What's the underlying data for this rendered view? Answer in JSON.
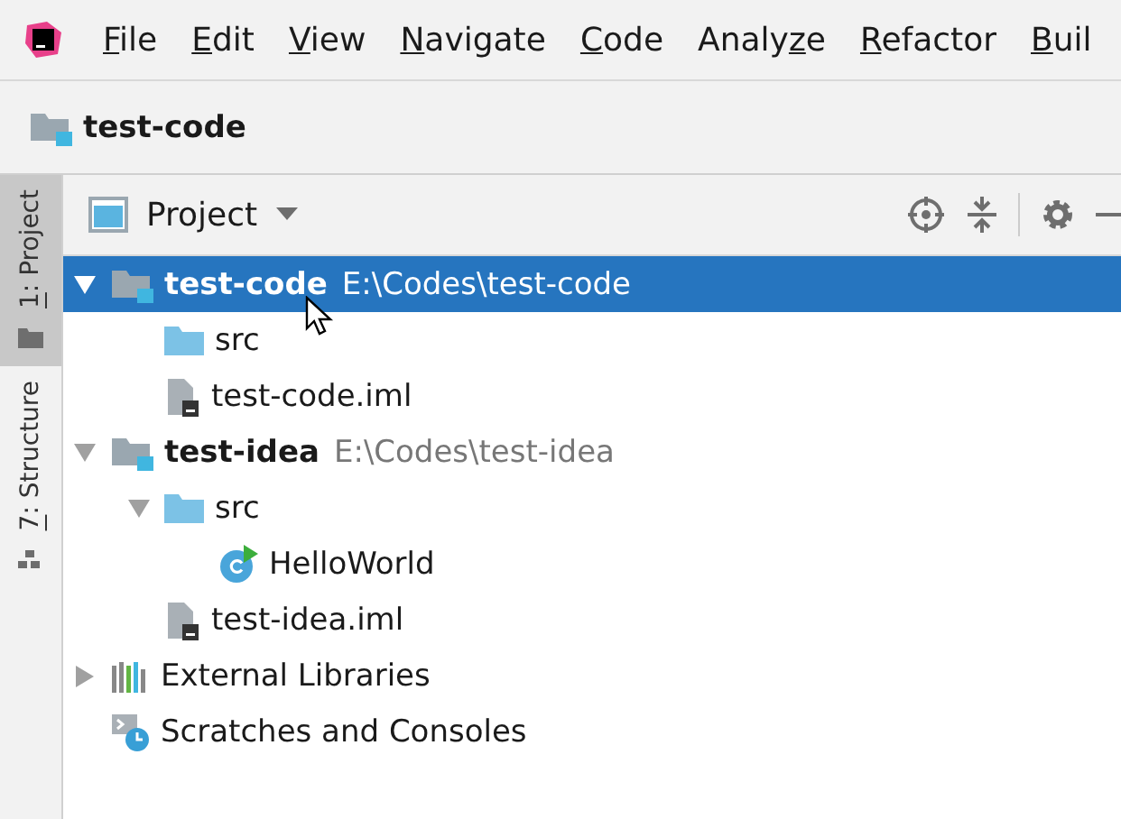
{
  "menu": [
    {
      "key": "F",
      "after": "ile"
    },
    {
      "key": "E",
      "after": "dit"
    },
    {
      "key": "V",
      "after": "iew"
    },
    {
      "key": "N",
      "after": "avigate"
    },
    {
      "key": "C",
      "after": "ode"
    },
    {
      "before": "Analy",
      "key": "z",
      "after": "e"
    },
    {
      "key": "R",
      "after": "efactor"
    },
    {
      "key": "B",
      "after": "uil"
    }
  ],
  "breadcrumb": {
    "label": "test-code"
  },
  "side_tabs": [
    {
      "key": "1",
      "after": ": Project",
      "selected": true,
      "kind": "folder"
    },
    {
      "key": "7",
      "after": ": Structure",
      "selected": false,
      "kind": "structure"
    }
  ],
  "tool_window": {
    "title": "Project"
  },
  "tree": [
    {
      "kind": "module",
      "name": "test-code",
      "path": "E:\\Codes\\test-code",
      "expanded": true,
      "selected": true,
      "children": [
        {
          "kind": "folder",
          "name": "src",
          "selected": false
        },
        {
          "kind": "iml",
          "name": "test-code.iml",
          "selected": false
        }
      ]
    },
    {
      "kind": "module",
      "name": "test-idea",
      "path": "E:\\Codes\\test-idea",
      "expanded": true,
      "selected": false,
      "children": [
        {
          "kind": "folder",
          "name": "src",
          "expanded": true,
          "selected": false,
          "children": [
            {
              "kind": "class",
              "name": "HelloWorld",
              "selected": false
            }
          ]
        },
        {
          "kind": "iml",
          "name": "test-idea.iml",
          "selected": false
        }
      ]
    },
    {
      "kind": "libraries",
      "name": "External Libraries",
      "expanded": false,
      "selected": false
    },
    {
      "kind": "scratches",
      "name": "Scratches and Consoles",
      "selected": false
    }
  ]
}
